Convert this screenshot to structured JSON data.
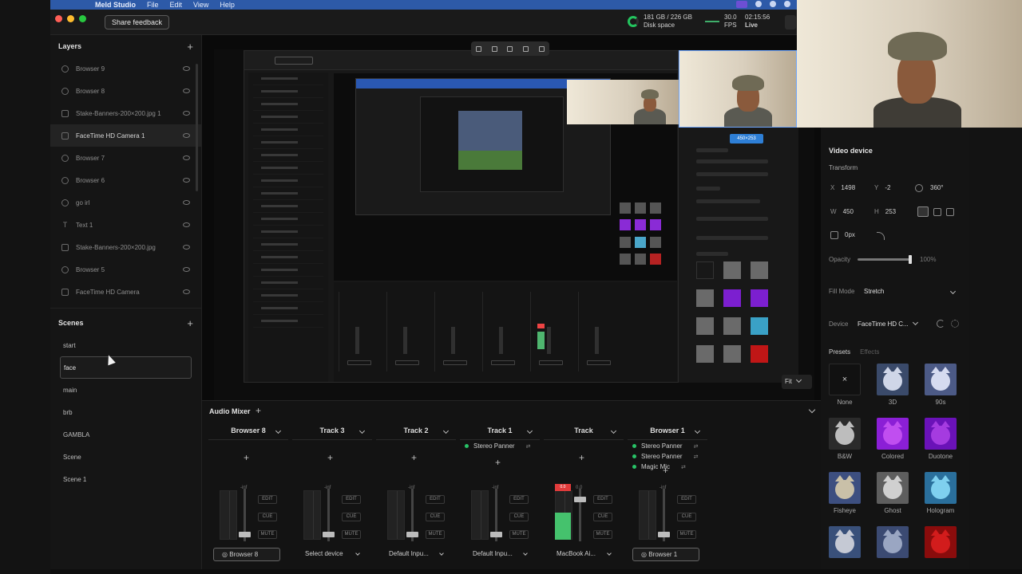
{
  "menubar": {
    "app": "Meld Studio",
    "items": [
      "File",
      "Edit",
      "View",
      "Help"
    ]
  },
  "topbar": {
    "feedback": "Share feedback",
    "disk_value": "181 GB / 226 GB",
    "disk_label": "Disk space",
    "fps_value": "30.0",
    "fps_label": "FPS",
    "time": "02:15:56",
    "live_label": "Live"
  },
  "layers": {
    "title": "Layers",
    "add": "+",
    "items": [
      {
        "name": "Browser 9",
        "icon": "globe-icon"
      },
      {
        "name": "Browser 8",
        "icon": "globe-icon"
      },
      {
        "name": "Stake-Banners-200×200.jpg 1",
        "icon": "image-icon"
      },
      {
        "name": "FaceTime HD Camera 1",
        "icon": "camera-icon",
        "selected": true
      },
      {
        "name": "Browser 7",
        "icon": "globe-icon"
      },
      {
        "name": "Browser 6",
        "icon": "globe-icon"
      },
      {
        "name": "go irl",
        "icon": "globe-icon"
      },
      {
        "name": "Text 1",
        "icon": "text-icon"
      },
      {
        "name": "Stake-Banners-200×200.jpg",
        "icon": "image-icon"
      },
      {
        "name": "Browser 5",
        "icon": "globe-icon"
      },
      {
        "name": "FaceTime HD Camera",
        "icon": "camera-icon"
      }
    ]
  },
  "scenes": {
    "title": "Scenes",
    "add": "+",
    "items": [
      "start",
      "face",
      "main",
      "brb",
      "GAMBLA",
      "Scene",
      "Scene 1"
    ],
    "selected": "face"
  },
  "stage": {
    "fit_label": "Fit",
    "inner_badge": "450×253"
  },
  "props": {
    "title": "Video device",
    "transform": "Transform",
    "x_label": "X",
    "x_value": "1498",
    "y_label": "Y",
    "y_value": "-2",
    "rot_value": "360°",
    "w_label": "W",
    "w_value": "450",
    "h_label": "H",
    "h_value": "253",
    "radius_value": "0px",
    "opacity_label": "Opacity",
    "opacity_value": "100%",
    "opacity_level": 1.0,
    "fill_mode_label": "Fill Mode",
    "fill_mode_value": "Stretch",
    "device_label": "Device",
    "device_value": "FaceTime HD C...",
    "tab_presets": "Presets",
    "tab_effects": "Effects",
    "presets": [
      "None",
      "3D",
      "90s",
      "B&W",
      "Colored",
      "Duotone",
      "Fisheye",
      "Ghost",
      "Hologram",
      "",
      "",
      ""
    ]
  },
  "mixer": {
    "title": "Audio Mixer",
    "add": "+",
    "db_label": "-inf",
    "edit": "EDIT",
    "cue": "CUE",
    "mute": "MUTE",
    "clip_label": "0.0",
    "strips": [
      {
        "name": "Browser 8",
        "device": "Browser 8",
        "device_boxed": true,
        "fx": [],
        "level": 0.0
      },
      {
        "name": "Track 3",
        "device": "Select device",
        "device_boxed": false,
        "fx": [],
        "level": 0.0
      },
      {
        "name": "Track 2",
        "device": "Default Inpu...",
        "device_boxed": false,
        "fx": [],
        "level": 0.0
      },
      {
        "name": "Track 1",
        "device": "Default Inpu...",
        "device_boxed": false,
        "fx": [
          "Stereo Panner"
        ],
        "level": 0.0
      },
      {
        "name": "Track",
        "device": "MacBook Ai...",
        "device_boxed": false,
        "fx": [],
        "level": 0.55
      },
      {
        "name": "Browser 1",
        "device": "Browser 1",
        "device_boxed": true,
        "fx": [
          "Stereo Panner",
          "Stereo Panner",
          "Magic Mic"
        ],
        "level": 0.0
      }
    ]
  }
}
